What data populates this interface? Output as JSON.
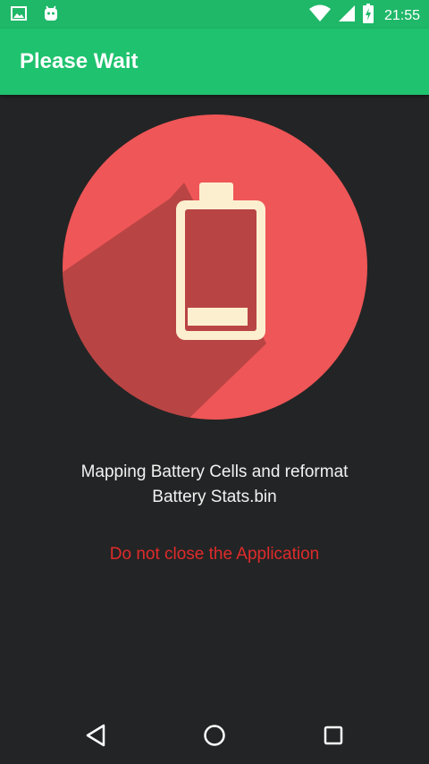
{
  "status_bar": {
    "time": "21:55",
    "icons": [
      "gallery-notification-icon",
      "android-notification-icon",
      "wifi-icon",
      "cell-signal-icon",
      "battery-charging-icon"
    ]
  },
  "app_bar": {
    "title": "Please Wait"
  },
  "illustration": {
    "icon": "battery-low-icon",
    "colors": {
      "circle": "#ef5657",
      "shadow": "#b94444",
      "battery_outline": "#fcefd0",
      "battery_fill": "#b94444"
    }
  },
  "content": {
    "message_line1": "Mapping Battery Cells and reformat",
    "message_line2": "Battery Stats.bin",
    "warning": "Do not close the Application"
  },
  "nav_bar": {
    "buttons": [
      "back-icon",
      "home-icon",
      "recents-icon"
    ]
  },
  "colors": {
    "accent": "#1fc26e",
    "background": "#232425",
    "warning": "#e02b2b"
  }
}
